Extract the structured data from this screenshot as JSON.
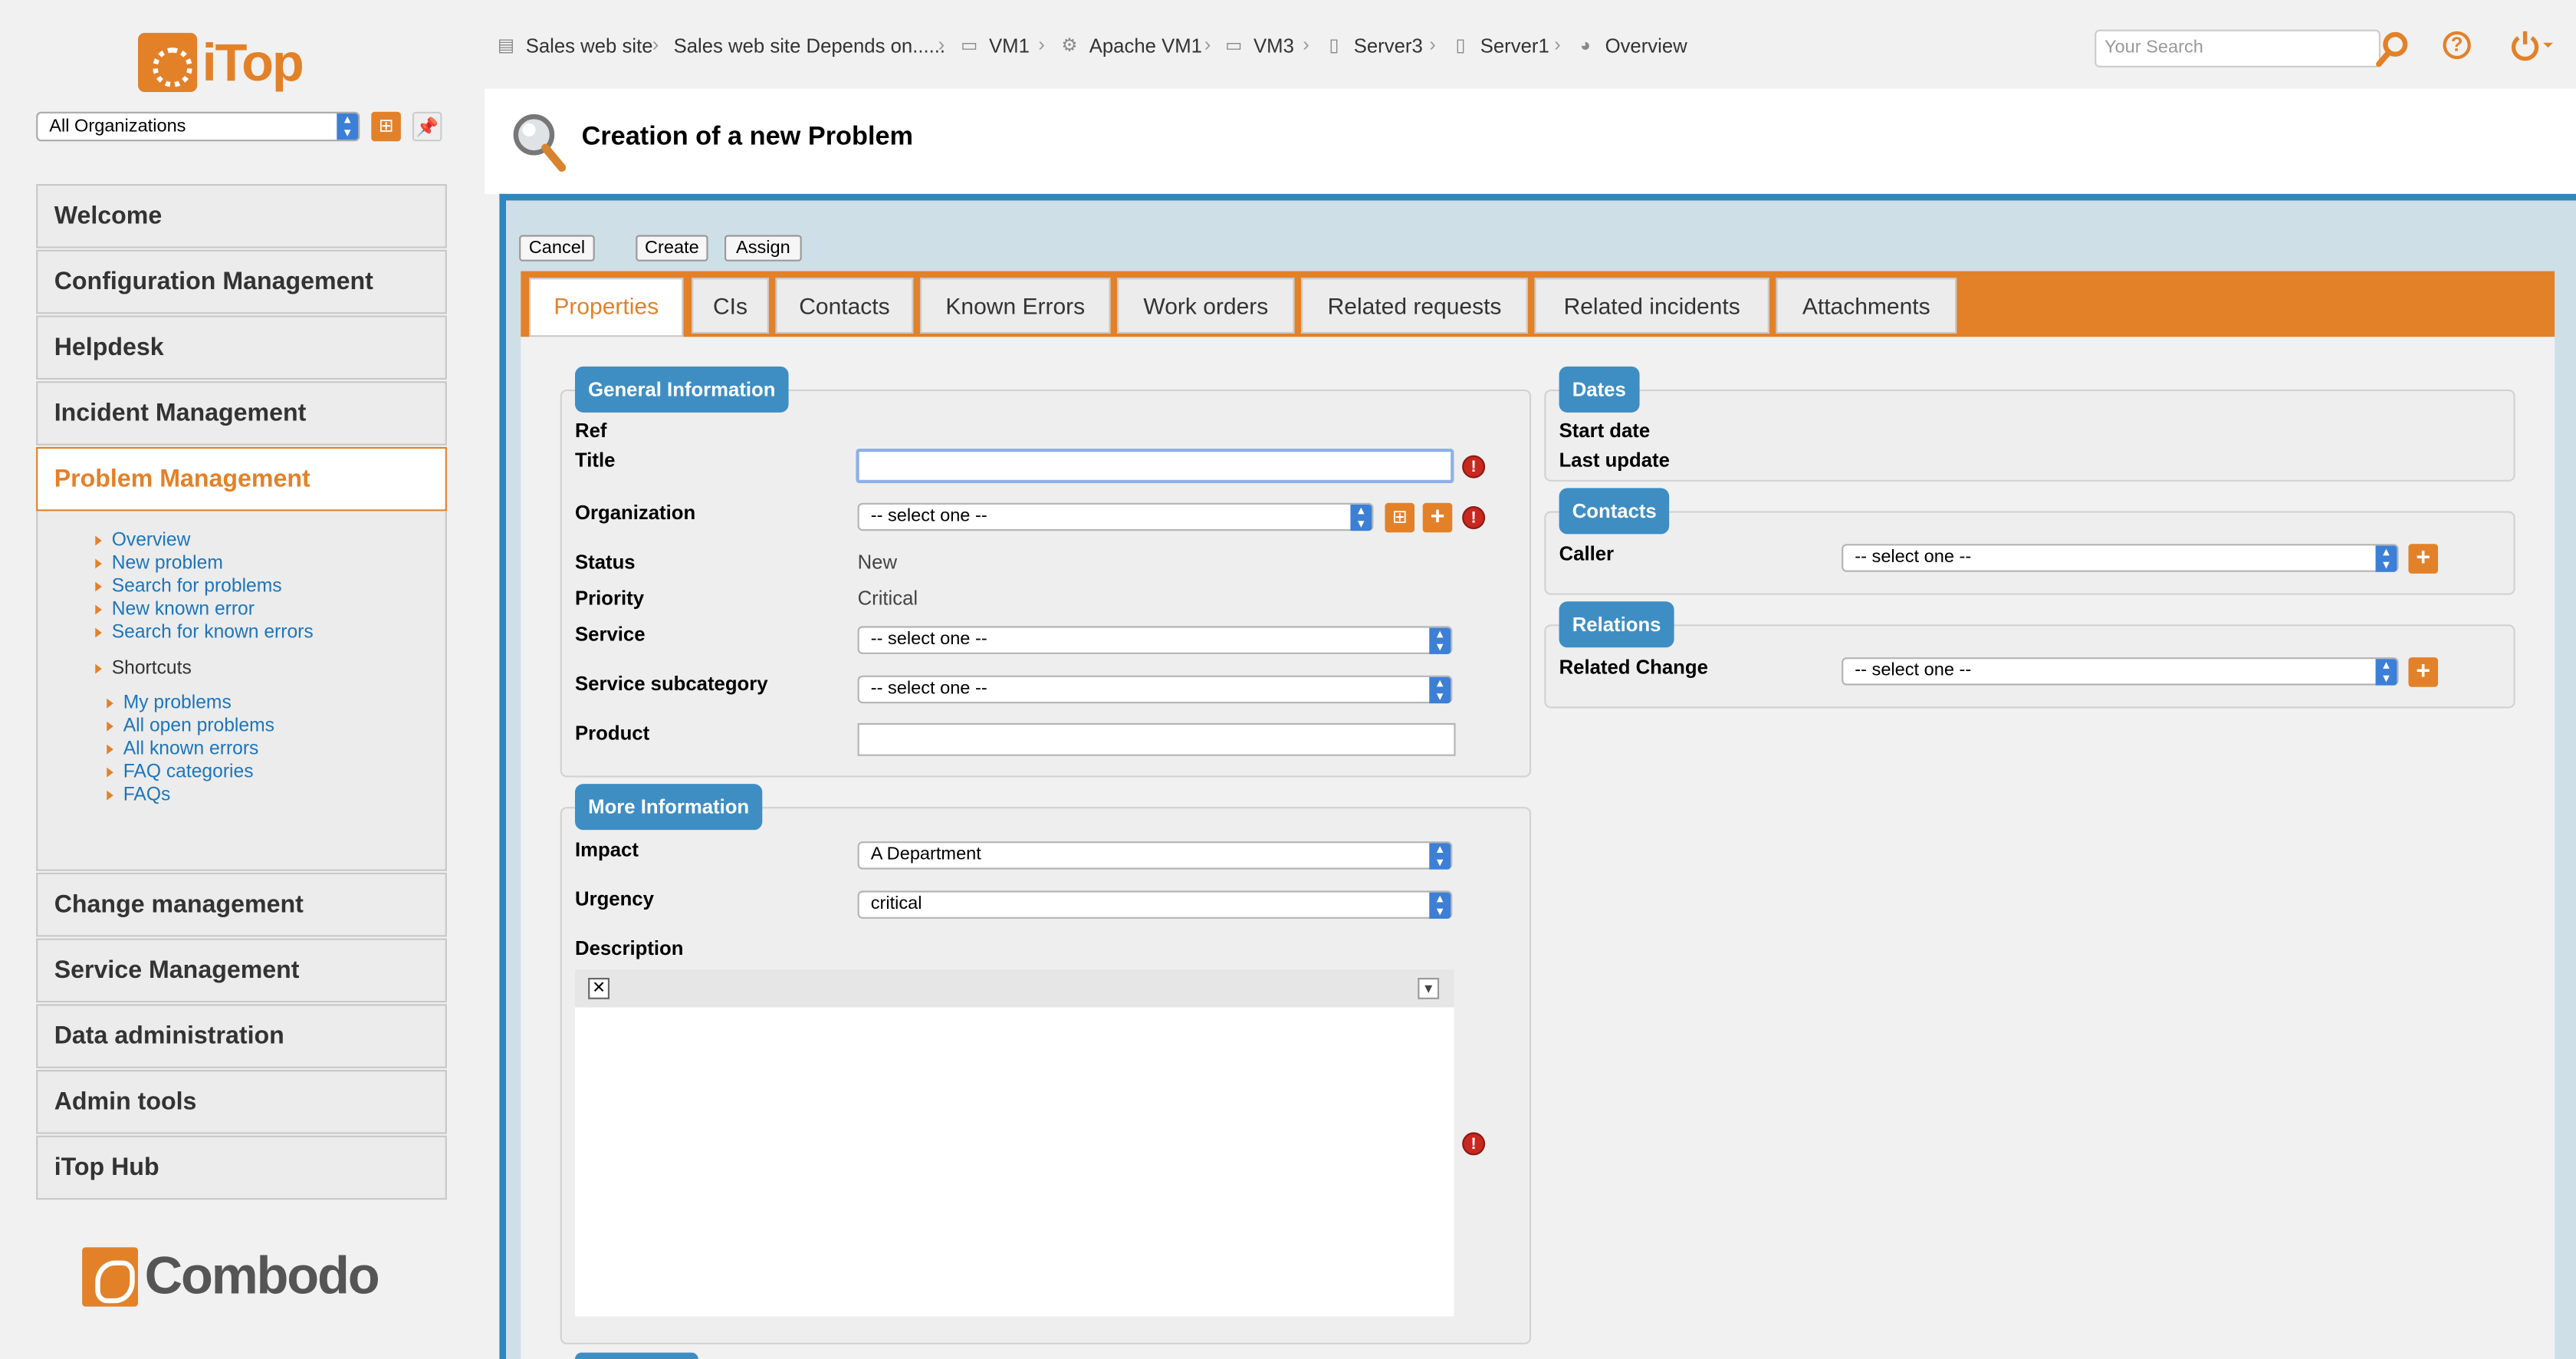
{
  "app": {
    "logo_text": "iTop",
    "vendor_text": "Combodo"
  },
  "org_selector": {
    "value": "All Organizations"
  },
  "nav": {
    "sections": [
      {
        "label": "Welcome"
      },
      {
        "label": "Configuration Management"
      },
      {
        "label": "Helpdesk"
      },
      {
        "label": "Incident Management"
      },
      {
        "label": "Problem Management"
      },
      {
        "label": "Change management"
      },
      {
        "label": "Service Management"
      },
      {
        "label": "Data administration"
      },
      {
        "label": "Admin tools"
      },
      {
        "label": "iTop Hub"
      }
    ],
    "problem_items": [
      "Overview",
      "New problem",
      "Search for problems",
      "New known error",
      "Search for known errors"
    ],
    "shortcuts_label": "Shortcuts",
    "shortcuts": [
      "My problems",
      "All open problems",
      "All known errors",
      "FAQ categories",
      "FAQs"
    ]
  },
  "breadcrumbs": [
    {
      "label": "Sales web site",
      "icon": "application-icon"
    },
    {
      "label": "Sales web site Depends on......",
      "icon": ""
    },
    {
      "label": "VM1",
      "icon": "server-icon"
    },
    {
      "label": "Apache VM1",
      "icon": "webserver-icon"
    },
    {
      "label": "VM3",
      "icon": "server-icon"
    },
    {
      "label": "Server3",
      "icon": "server-icon"
    },
    {
      "label": "Server1",
      "icon": "server-icon"
    },
    {
      "label": "Overview",
      "icon": "pie-chart-icon"
    }
  ],
  "search": {
    "placeholder": "Your Search"
  },
  "page": {
    "title": "Creation of a new Problem"
  },
  "actions": {
    "cancel": "Cancel",
    "create": "Create",
    "assign": "Assign"
  },
  "tabs": [
    "Properties",
    "CIs",
    "Contacts",
    "Known Errors",
    "Work orders",
    "Related requests",
    "Related incidents",
    "Attachments"
  ],
  "general": {
    "legend": "General Information",
    "ref_label": "Ref",
    "title_label": "Title",
    "org_label": "Organization",
    "org_value": "-- select one --",
    "status_label": "Status",
    "status_value": "New",
    "priority_label": "Priority",
    "priority_value": "Critical",
    "service_label": "Service",
    "service_value": "-- select one --",
    "subcat_label": "Service subcategory",
    "subcat_value": "-- select one --",
    "product_label": "Product"
  },
  "more": {
    "legend": "More Information",
    "impact_label": "Impact",
    "impact_value": "A Department",
    "urgency_label": "Urgency",
    "urgency_value": "critical",
    "description_label": "Description"
  },
  "dates": {
    "legend": "Dates",
    "start_label": "Start date",
    "update_label": "Last update"
  },
  "contacts": {
    "legend": "Contacts",
    "caller_label": "Caller",
    "caller_value": "-- select one --"
  },
  "relations": {
    "legend": "Relations",
    "change_label": "Related Change",
    "change_value": "-- select one --"
  },
  "colors": {
    "accent": "#e38129",
    "blue": "#3e8ec3",
    "panel_border": "#2e87bf",
    "error": "#c8281e",
    "link": "#1c75bc"
  }
}
